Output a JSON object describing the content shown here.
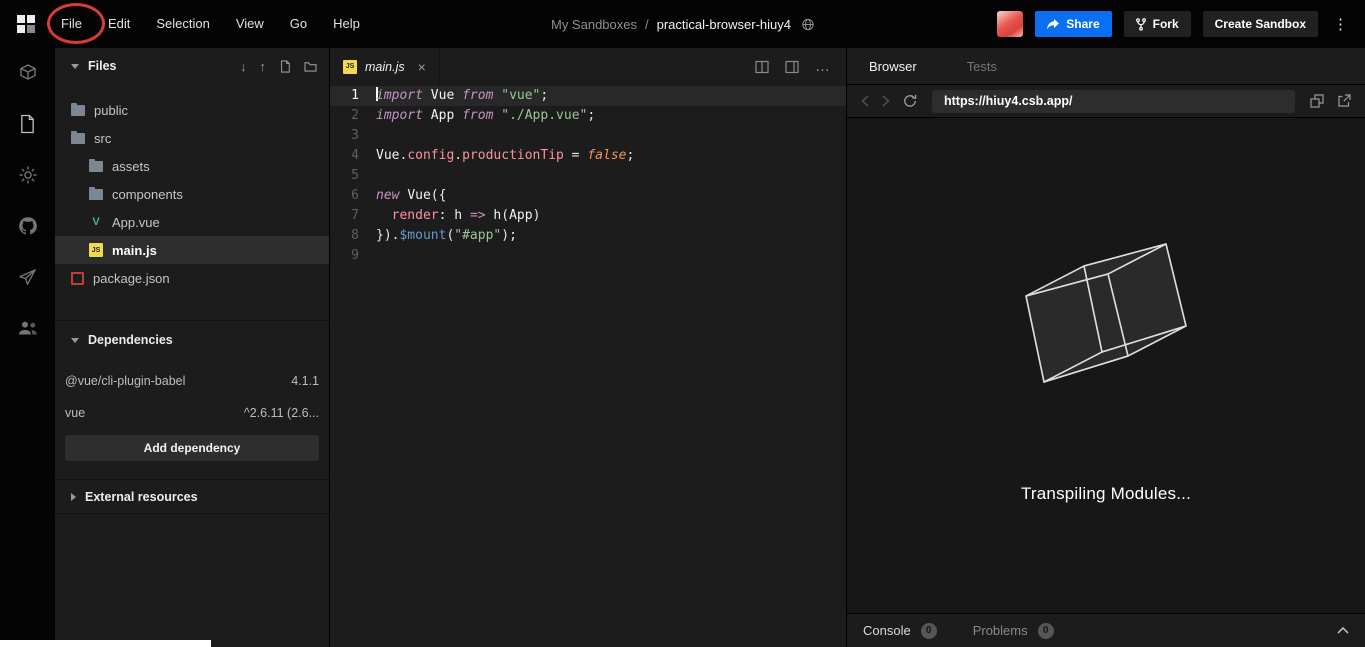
{
  "colors": {
    "accent_blue": "#0971f1",
    "annotation_red": "#d93b3b",
    "js_yellow": "#f3d94e",
    "vue_green": "#41b883",
    "npm_red": "#c23c39",
    "selection_bg": "#2d2d2d"
  },
  "header": {
    "menu": [
      "File",
      "Edit",
      "Selection",
      "View",
      "Go",
      "Help"
    ],
    "breadcrumb": {
      "parent": "My Sandboxes",
      "separator": "/",
      "title": "practical-browser-hiuy4"
    },
    "actions": {
      "share": "Share",
      "fork": "Fork",
      "create_sandbox": "Create Sandbox"
    }
  },
  "files": {
    "title": "Files",
    "tree": [
      {
        "label": "public",
        "type": "folder",
        "indent": 0
      },
      {
        "label": "src",
        "type": "folder",
        "indent": 0
      },
      {
        "label": "assets",
        "type": "folder",
        "indent": 1
      },
      {
        "label": "components",
        "type": "folder",
        "indent": 1
      },
      {
        "label": "App.vue",
        "type": "vue",
        "indent": 1
      },
      {
        "label": "main.js",
        "type": "js",
        "indent": 1,
        "selected": true
      },
      {
        "label": "package.json",
        "type": "npm",
        "indent": 0
      }
    ],
    "dependencies": {
      "title": "Dependencies",
      "items": [
        {
          "name": "@vue/cli-plugin-babel",
          "version": "4.1.1"
        },
        {
          "name": "vue",
          "version": "^2.6.11 (2.6..."
        }
      ],
      "add_button": "Add dependency"
    },
    "external_resources": {
      "title": "External resources"
    }
  },
  "editor": {
    "tab": {
      "label": "main.js",
      "close": "×"
    },
    "lines": [
      {
        "num": "1",
        "active": true,
        "tokens": [
          [
            "kw",
            "import"
          ],
          [
            "pl",
            " "
          ],
          [
            "id",
            "Vue"
          ],
          [
            "pl",
            " "
          ],
          [
            "kw",
            "from"
          ],
          [
            "pl",
            " "
          ],
          [
            "str",
            "\"vue\""
          ],
          [
            "pl",
            ";"
          ]
        ]
      },
      {
        "num": "2",
        "tokens": [
          [
            "kw",
            "import"
          ],
          [
            "pl",
            " "
          ],
          [
            "id",
            "App"
          ],
          [
            "pl",
            " "
          ],
          [
            "kw",
            "from"
          ],
          [
            "pl",
            " "
          ],
          [
            "str",
            "\"./App.vue\""
          ],
          [
            "pl",
            ";"
          ]
        ]
      },
      {
        "num": "3",
        "tokens": []
      },
      {
        "num": "4",
        "tokens": [
          [
            "id",
            "Vue"
          ],
          [
            "pl",
            "."
          ],
          [
            "prop",
            "config"
          ],
          [
            "pl",
            "."
          ],
          [
            "prop",
            "productionTip"
          ],
          [
            "pl",
            " = "
          ],
          [
            "bool",
            "false"
          ],
          [
            "pl",
            ";"
          ]
        ]
      },
      {
        "num": "5",
        "tokens": []
      },
      {
        "num": "6",
        "tokens": [
          [
            "kw",
            "new"
          ],
          [
            "pl",
            " "
          ],
          [
            "id",
            "Vue"
          ],
          [
            "pl",
            "({"
          ]
        ]
      },
      {
        "num": "7",
        "tokens": [
          [
            "pl",
            "  "
          ],
          [
            "prop",
            "render"
          ],
          [
            "pl",
            ": "
          ],
          [
            "id",
            "h"
          ],
          [
            "pl",
            " "
          ],
          [
            "arrow",
            "=>"
          ],
          [
            "pl",
            " "
          ],
          [
            "id",
            "h"
          ],
          [
            "pl",
            "("
          ],
          [
            "id",
            "App"
          ],
          [
            "pl",
            ")"
          ]
        ]
      },
      {
        "num": "8",
        "tokens": [
          [
            "pl",
            "})."
          ],
          [
            "fn",
            "$mount"
          ],
          [
            "pl",
            "("
          ],
          [
            "str",
            "\"#app\""
          ],
          [
            "pl",
            ");"
          ]
        ]
      },
      {
        "num": "9",
        "tokens": []
      }
    ]
  },
  "preview": {
    "tabs": [
      {
        "label": "Browser",
        "active": true
      },
      {
        "label": "Tests",
        "active": false
      }
    ],
    "url": "https://hiuy4.csb.app/",
    "status_text": "Transpiling Modules...",
    "console_bar": {
      "console_label": "Console",
      "console_count": "0",
      "problems_label": "Problems",
      "problems_count": "0"
    }
  }
}
